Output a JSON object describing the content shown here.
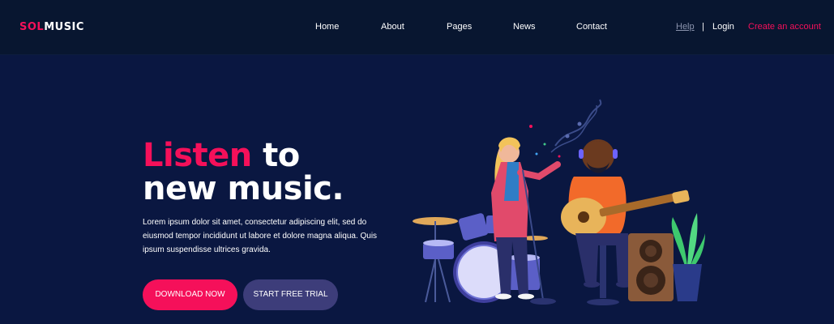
{
  "brand": {
    "accent": "SOL",
    "rest": "MUSIC"
  },
  "nav": {
    "items": [
      "Home",
      "About",
      "Pages",
      "News",
      "Contact"
    ],
    "help": "Help",
    "separator": "|",
    "login": "Login",
    "create_account": "Create an account"
  },
  "hero": {
    "title_accent": "Listen",
    "title_line1_rest": " to",
    "title_line2": "new music.",
    "description": "Lorem ipsum dolor sit amet, consectetur adipiscing elit, sed do eiusmod tempor incididunt ut labore et dolore magna aliqua. Quis ipsum suspendisse ultrices gravida.",
    "download_label": "DOWNLOAD NOW",
    "trial_label": "START FREE TRIAL"
  },
  "illustration": {
    "subject": "band-singer-and-guitarist"
  },
  "colors": {
    "background": "#0a1741",
    "header": "#081630",
    "accent": "#f5105a",
    "secondary_button": "#3d3d7a"
  }
}
